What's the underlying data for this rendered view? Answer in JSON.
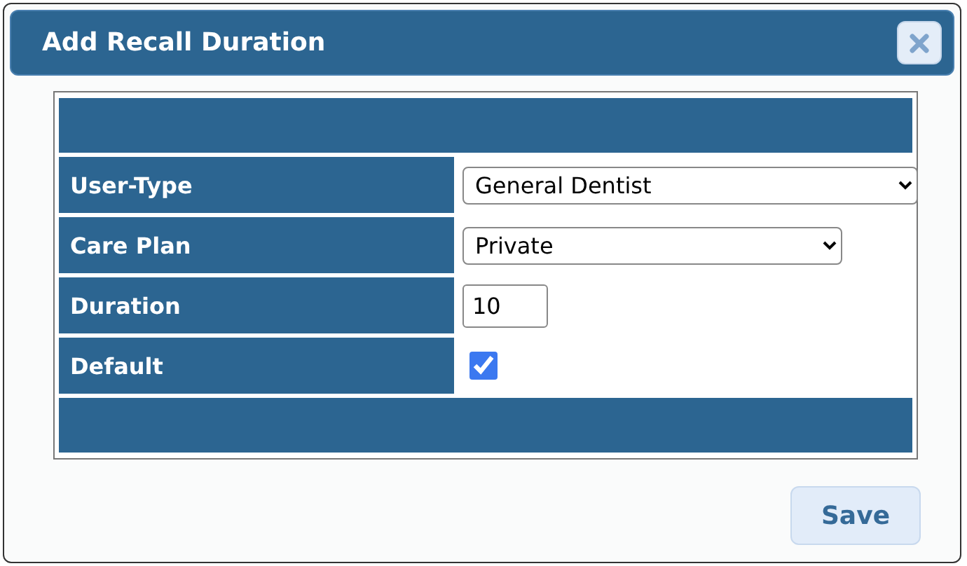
{
  "dialog": {
    "title": "Add Recall Duration"
  },
  "fields": [
    {
      "label": "User-Type",
      "kind": "select",
      "value": "General Dentist"
    },
    {
      "label": "Care Plan",
      "kind": "select",
      "value": "Private"
    },
    {
      "label": "Duration",
      "kind": "text",
      "value": "10"
    },
    {
      "label": "Default",
      "kind": "checkbox",
      "checked": true
    }
  ],
  "buttons": [
    {
      "label": "Save"
    }
  ]
}
